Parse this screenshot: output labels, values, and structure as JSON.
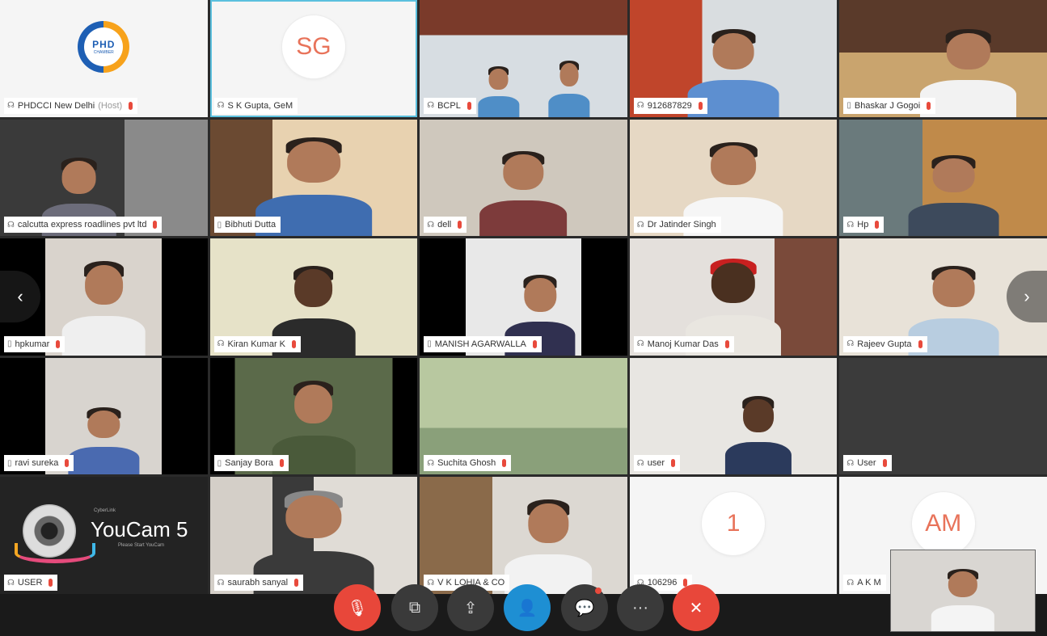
{
  "colors": {
    "accent": "#1e8fd3",
    "danger": "#e8473a",
    "mic_muted": "#e84a3c",
    "active_border": "#5bc0de"
  },
  "tiles": [
    {
      "name": "PHDCCI New Delhi",
      "host_tag": "(Host)",
      "type": "logo"
    },
    {
      "name": "S K Gupta, GeM",
      "type": "initials",
      "initials": "SG"
    },
    {
      "name": "BCPL",
      "type": "video"
    },
    {
      "name": "912687829",
      "type": "video"
    },
    {
      "name": "Bhaskar J Gogoi",
      "type": "video"
    },
    {
      "name": "calcutta express roadlines pvt ltd",
      "type": "video"
    },
    {
      "name": "Bibhuti Dutta",
      "type": "video"
    },
    {
      "name": "dell",
      "type": "video"
    },
    {
      "name": "Dr Jatinder Singh",
      "type": "video"
    },
    {
      "name": "Hp",
      "type": "video"
    },
    {
      "name": "hpkumar",
      "type": "video"
    },
    {
      "name": "Kiran Kumar K",
      "type": "video"
    },
    {
      "name": "MANISH AGARWALLA",
      "type": "video"
    },
    {
      "name": "Manoj Kumar Das",
      "type": "video"
    },
    {
      "name": "Rajeev Gupta",
      "type": "video"
    },
    {
      "name": "ravi surekа",
      "type": "video"
    },
    {
      "name": "Sanjay Bora",
      "type": "video"
    },
    {
      "name": "Suchita Ghosh",
      "type": "video"
    },
    {
      "name": "user",
      "type": "video"
    },
    {
      "name": "User",
      "type": "dark"
    },
    {
      "name": "USER",
      "type": "youcam",
      "brand": "YouCam 5",
      "tagline": "CyberLink",
      "subtext": "Please Start YouCam"
    },
    {
      "name": "saurabh sanyal",
      "type": "video"
    },
    {
      "name": "V K LOHIA & CO",
      "type": "video"
    },
    {
      "name": "106296",
      "type": "initials",
      "initials": "1"
    },
    {
      "name": "A K M",
      "type": "initials",
      "initials": "AM"
    }
  ],
  "logo": {
    "text": "PHD",
    "subtext": "CHAMBER"
  },
  "toolbar": {
    "mute_icon": "🎙",
    "video_icon": "⧉",
    "share_icon": "⇪",
    "participants_icon": "👤",
    "chat_icon": "💬",
    "more_icon": "···",
    "end_icon": "✕"
  },
  "nav": {
    "prev": "‹",
    "next": "›"
  }
}
